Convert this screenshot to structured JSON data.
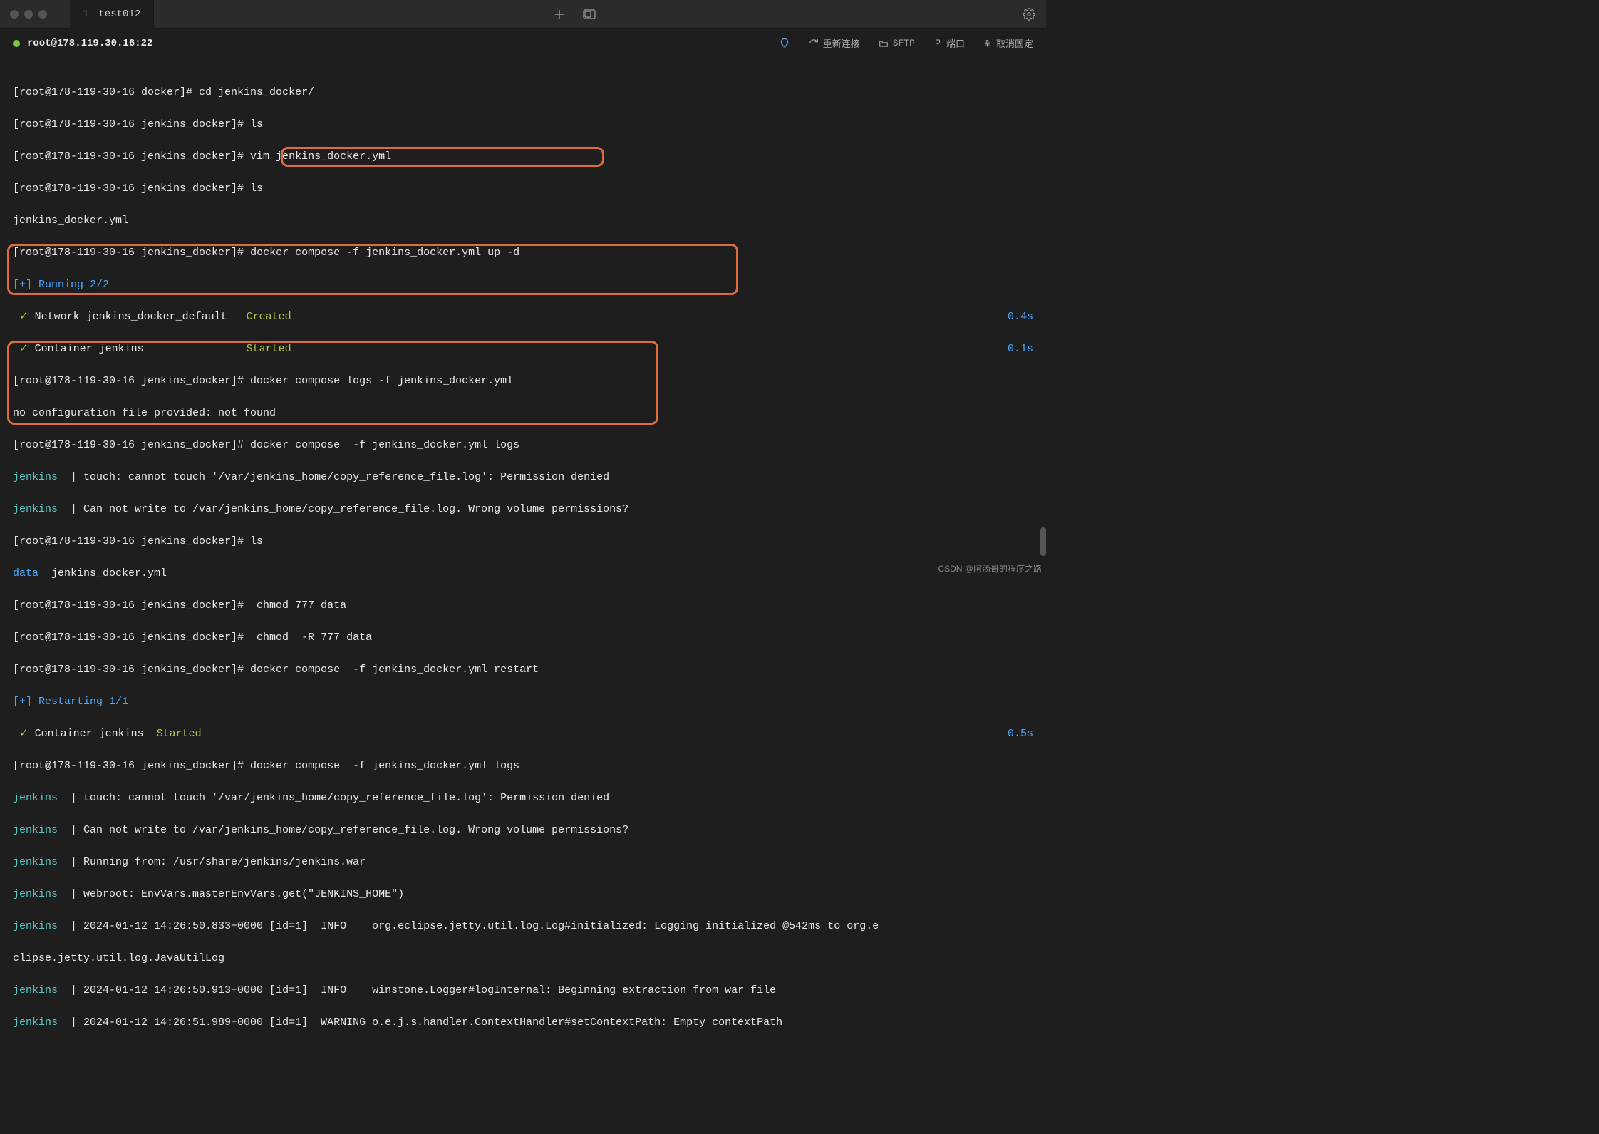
{
  "titlebar": {
    "tab_number": "1",
    "tab_name": "test012"
  },
  "actionbar": {
    "host": "root@178.119.30.16:22",
    "reconnect": "重新连接",
    "sftp": "SFTP",
    "port": "端口",
    "unpin": "取消固定"
  },
  "term": {
    "l1": "[root@178-119-30-16 docker]# cd jenkins_docker/",
    "l2": "[root@178-119-30-16 jenkins_docker]# ls",
    "l3": "[root@178-119-30-16 jenkins_docker]# vim jenkins_docker.yml",
    "l4": "[root@178-119-30-16 jenkins_docker]# ls",
    "l5": "jenkins_docker.yml",
    "l6p": "[root@178-119-30-16 jenkins_docker]# ",
    "l6c": "docker compose -f jenkins_docker.yml up -d",
    "l7": "[+] Running 2/2",
    "l8a": " ✓ Network jenkins_docker_default   ",
    "l8b": "Created",
    "l8t": "0.4s",
    "l9a": " ✓ Container jenkins                ",
    "l9b": "Started",
    "l9t": "0.1s",
    "l10": "[root@178-119-30-16 jenkins_docker]# docker compose logs -f jenkins_docker.yml",
    "l11": "no configuration file provided: not found",
    "l12": "[root@178-119-30-16 jenkins_docker]# docker compose  -f jenkins_docker.yml logs",
    "l13a": "jenkins  ",
    "l13b": "| touch: cannot touch '/var/jenkins_home/copy_reference_file.log': Permission denied",
    "l14a": "jenkins  ",
    "l14b": "| Can not write to /var/jenkins_home/copy_reference_file.log. Wrong volume permissions?",
    "l15": "[root@178-119-30-16 jenkins_docker]# ls",
    "l16a": "data",
    "l16b": "  jenkins_docker.yml",
    "l17": "[root@178-119-30-16 jenkins_docker]#  chmod 777 data",
    "l18": "[root@178-119-30-16 jenkins_docker]#  chmod  -R 777 data",
    "l19": "[root@178-119-30-16 jenkins_docker]# docker compose  -f jenkins_docker.yml restart",
    "l20": "[+] Restarting 1/1",
    "l21a": " ✓ Container jenkins  ",
    "l21b": "Started",
    "l21t": "0.5s",
    "l22": "[root@178-119-30-16 jenkins_docker]# docker compose  -f jenkins_docker.yml logs",
    "l23a": "jenkins  ",
    "l23b": "| touch: cannot touch '/var/jenkins_home/copy_reference_file.log': Permission denied",
    "l24a": "jenkins  ",
    "l24b": "| Can not write to /var/jenkins_home/copy_reference_file.log. Wrong volume permissions?",
    "l25a": "jenkins  ",
    "l25b": "| Running from: /usr/share/jenkins/jenkins.war",
    "l26a": "jenkins  ",
    "l26b": "| webroot: EnvVars.masterEnvVars.get(\"JENKINS_HOME\")",
    "l27a": "jenkins  ",
    "l27b": "| 2024-01-12 14:26:50.833+0000 [id=1]  INFO    org.eclipse.jetty.util.log.Log#initialized: Logging initialized @542ms to org.e",
    "l28": "clipse.jetty.util.log.JavaUtilLog",
    "l29a": "jenkins  ",
    "l29b": "| 2024-01-12 14:26:50.913+0000 [id=1]  INFO    winstone.Logger#logInternal: Beginning extraction from war file",
    "l30a": "jenkins  ",
    "l30b": "| 2024-01-12 14:26:51.989+0000 [id=1]  WARNING o.e.j.s.handler.ContextHandler#setContextPath: Empty contextPath"
  },
  "watermark": "CSDN @阿汤哥的程序之路"
}
